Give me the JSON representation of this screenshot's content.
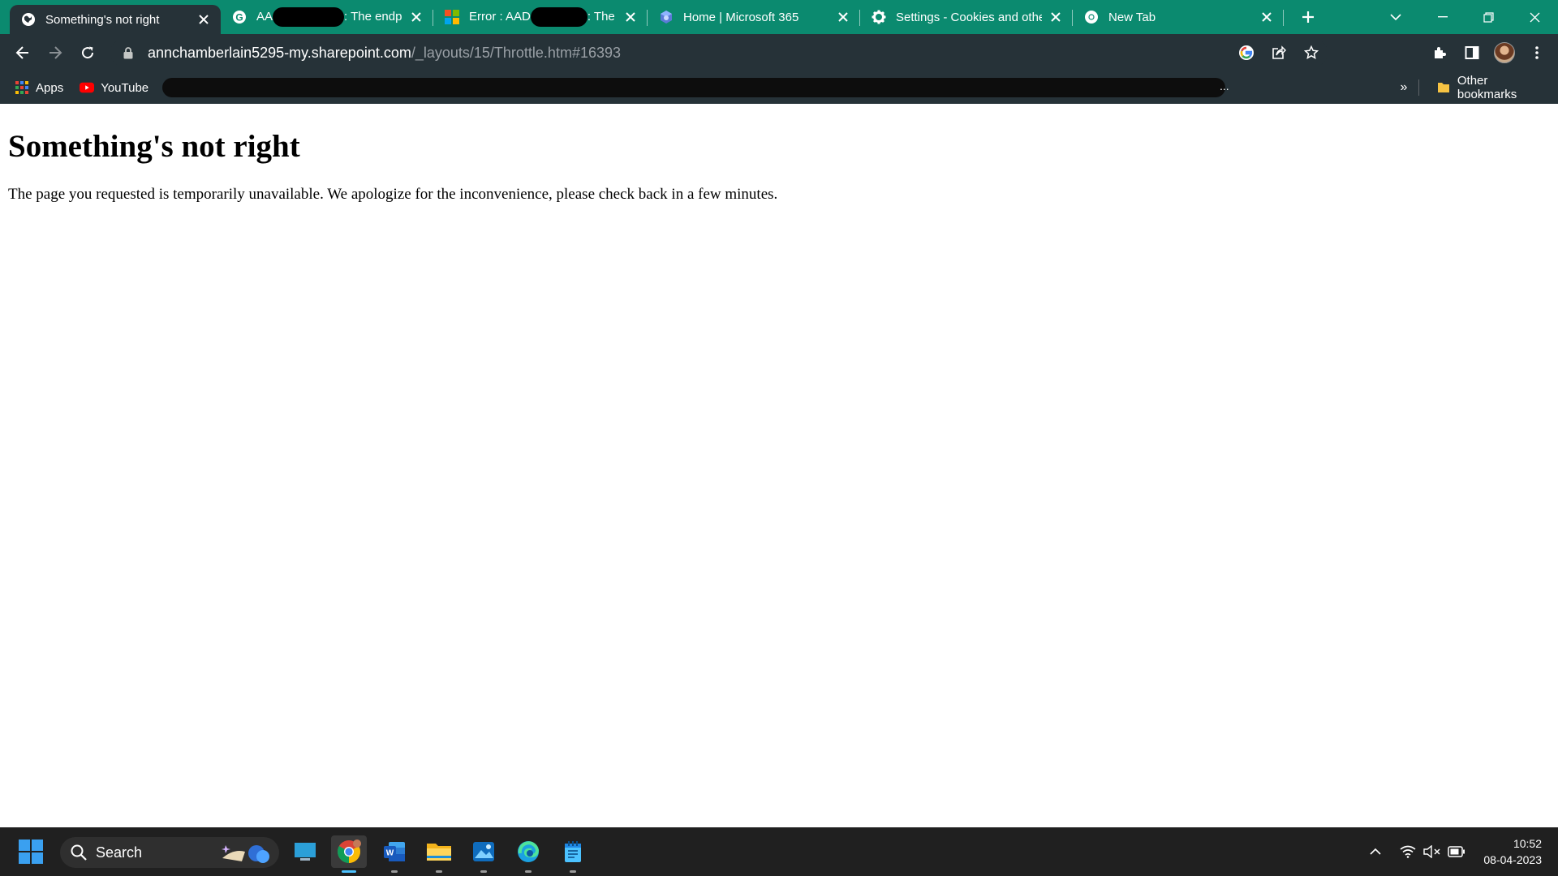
{
  "browser": {
    "tabs": [
      {
        "title": "Something's not right",
        "active": true,
        "icon": "globe-icon"
      },
      {
        "title_prefix": "AA",
        "title_suffix": ": The endpo",
        "icon": "google-icon"
      },
      {
        "title_prefix": "Error : AAD",
        "title_suffix": ": The",
        "icon": "microsoft-logo-icon"
      },
      {
        "title": "Home | Microsoft 365",
        "icon": "microsoft-365-icon"
      },
      {
        "title": "Settings - Cookies and othe",
        "icon": "gear-icon"
      },
      {
        "title": "New Tab",
        "icon": "chrome-icon"
      }
    ],
    "url_host": "annchamberlain5295-my.sharepoint.com",
    "url_path": "/_layouts/15/Throttle.htm#16393",
    "bookmarks": {
      "apps_label": "Apps",
      "youtube_label": "YouTube",
      "overflow_dots": "...",
      "overflow_chevron": "»",
      "other_label": "Other bookmarks"
    },
    "colors": {
      "tabstrip": "#0b8a6f",
      "toolbar": "#263238"
    }
  },
  "page": {
    "heading": "Something's not right",
    "message": "The page you requested is temporarily unavailable. We apologize for the inconvenience, please check back in a few minutes."
  },
  "taskbar": {
    "search_label": "Search",
    "time": "10:52",
    "date": "08-04-2023"
  }
}
